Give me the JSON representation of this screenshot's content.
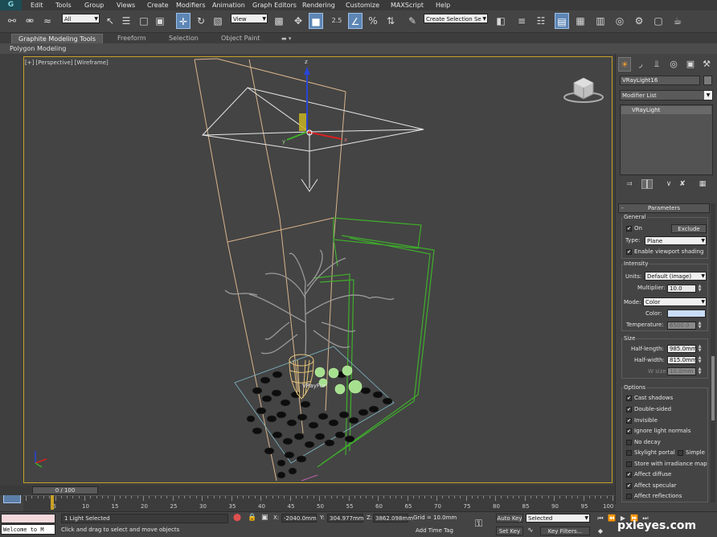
{
  "menubar": {
    "logo": "G",
    "items": [
      "Edit",
      "Tools",
      "Group",
      "Views",
      "Create",
      "Modifiers",
      "Animation",
      "Graph Editors",
      "Rendering",
      "Customize",
      "MAXScript",
      "Help"
    ]
  },
  "toolbar": {
    "selection_filter": "All",
    "ref_coord": "View",
    "snap_angle_label": "2.5",
    "named_selection": "Create Selection Se"
  },
  "ribbon": {
    "tabs": [
      "Graphite Modeling Tools",
      "Freeform",
      "Selection",
      "Object Paint"
    ],
    "active_tab": "Graphite Modeling Tools",
    "sub_label": "Polygon Modeling"
  },
  "viewport": {
    "label": "[+] [Perspective] [Wireframe]",
    "axis_z": "z",
    "axis_x": "x",
    "axis_y": "y",
    "object_label": "VRayFur"
  },
  "command_panel": {
    "object_name": "VRayLight16",
    "modifier_list": "Modifier List",
    "stack_item": "VRayLight",
    "rollout_title": "Parameters",
    "general": {
      "title": "General",
      "on_label": "On",
      "on_checked": true,
      "exclude_button": "Exclude",
      "type_label": "Type:",
      "type_value": "Plane",
      "viewport_shading_label": "Enable viewport shading",
      "viewport_shading_checked": true
    },
    "intensity": {
      "title": "Intensity",
      "units_label": "Units:",
      "units_value": "Default (image)",
      "multiplier_label": "Multiplier:",
      "multiplier_value": "10.0",
      "mode_label": "Mode:",
      "mode_value": "Color",
      "color_label": "Color:",
      "color_hex": "#c9dcf8",
      "temperature_label": "Temperature:",
      "temperature_value": "6500.0"
    },
    "size": {
      "title": "Size",
      "half_length_label": "Half-length:",
      "half_length_value": "985.0mm",
      "half_width_label": "Half-width:",
      "half_width_value": "815.0mm",
      "w_size_label": "W size",
      "w_size_value": "10.0mm"
    },
    "options": {
      "title": "Options",
      "items": [
        {
          "label": "Cast shadows",
          "checked": true
        },
        {
          "label": "Double-sided",
          "checked": true
        },
        {
          "label": "Invisible",
          "checked": true
        },
        {
          "label": "Ignore light normals",
          "checked": true
        },
        {
          "label": "No decay",
          "checked": false
        },
        {
          "label": "Skylight portal",
          "checked": false
        },
        {
          "label": "Store with irradiance map",
          "checked": false
        },
        {
          "label": "Affect diffuse",
          "checked": true
        },
        {
          "label": "Affect specular",
          "checked": true
        },
        {
          "label": "Affect reflections",
          "checked": false
        }
      ],
      "simple_label": "Simple",
      "simple_checked": false
    }
  },
  "timeline": {
    "frame_display": "0 / 100",
    "ticks": [
      "5",
      "10",
      "15",
      "20",
      "25",
      "30",
      "35",
      "40",
      "45",
      "50",
      "55",
      "60",
      "65",
      "70",
      "75",
      "80",
      "85",
      "90",
      "95",
      "100"
    ]
  },
  "status": {
    "maxscript": "Welcome to M",
    "selection": "1 Light Selected",
    "prompt": "Click and drag to select and move objects",
    "x_label": "X:",
    "x_value": "-2040.0mm",
    "y_label": "Y:",
    "y_value": "304.977mm",
    "z_label": "Z:",
    "z_value": "3862.098mm",
    "grid": "Grid = 10.0mm",
    "add_time_tag": "Add Time Tag",
    "auto_key": "Auto Key",
    "set_key": "Set Key",
    "selected_dd": "Selected",
    "key_filters": "Key Filters..."
  },
  "watermark": {
    "text": "pxleyes.com"
  },
  "colors": {
    "viewport_border": "#c6a227",
    "active_tool": "#5d86b5",
    "wire_green": "#3fae2b",
    "wire_tan": "#d9b48c",
    "light_plane": "#e8e8e8",
    "axis_blue": "#2845d8",
    "axis_red": "#d82020"
  }
}
